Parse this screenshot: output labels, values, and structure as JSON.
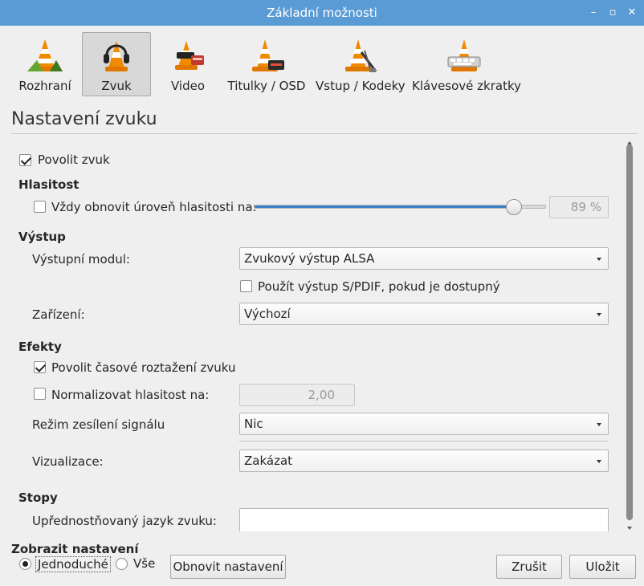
{
  "window": {
    "title": "Základní možnosti",
    "ctrl_min": "–",
    "ctrl_max": "▫",
    "ctrl_close": "✕"
  },
  "tabs": [
    {
      "label": "Rozhraní",
      "icon": "vlc-cone-icon"
    },
    {
      "label": "Zvuk",
      "icon": "vlc-headphones-icon",
      "active": true
    },
    {
      "label": "Video",
      "icon": "vlc-video-icon"
    },
    {
      "label": "Titulky / OSD",
      "icon": "vlc-subtitles-icon"
    },
    {
      "label": "Vstup / Kodeky",
      "icon": "vlc-input-codecs-icon"
    },
    {
      "label": "Klávesové zkratky",
      "icon": "vlc-hotkeys-icon"
    }
  ],
  "section_title": "Nastavení zvuku",
  "audio": {
    "enable_label": "Povolit zvuk",
    "enable_checked": true,
    "volume_heading": "Hlasitost",
    "restore_volume_label": "Vždy obnovit úroveň hlasitosti na:",
    "restore_volume_checked": false,
    "volume_level": 0.89,
    "volume_value": "89 %",
    "output_heading": "Výstup",
    "output_module_label": "Výstupní modul:",
    "output_module_value": "Zvukový výstup ALSA",
    "spdif_label": "Použít výstup S/PDIF, pokud je dostupný",
    "spdif_checked": false,
    "device_label": "Zařízení:",
    "device_value": "Výchozí",
    "effects_heading": "Efekty",
    "timestretch_label": "Povolit časové roztažení zvuku",
    "timestretch_checked": true,
    "normalize_label": "Normalizovat hlasitost na:",
    "normalize_checked": false,
    "normalize_value": "2,00",
    "replaygain_label": "Režim zesílení signálu",
    "replaygain_value": "Nic",
    "visualization_label": "Vizualizace:",
    "visualization_value": "Zakázat",
    "tracks_heading": "Stopy",
    "preferred_lang_label": "Upřednostňovaný jazyk zvuku:",
    "preferred_lang_value": ""
  },
  "footer": {
    "show_settings_label": "Zobrazit nastavení",
    "simple_label": "Jednoduché",
    "simple_selected": true,
    "all_label": "Vše",
    "reset_label": "Obnovit nastavení",
    "cancel_label": "Zrušit",
    "save_label": "Uložit"
  },
  "colors": {
    "titlebar": "#5b9bd5",
    "slider_fill": "#3d7fc9",
    "cone_orange": "#f08a00"
  }
}
